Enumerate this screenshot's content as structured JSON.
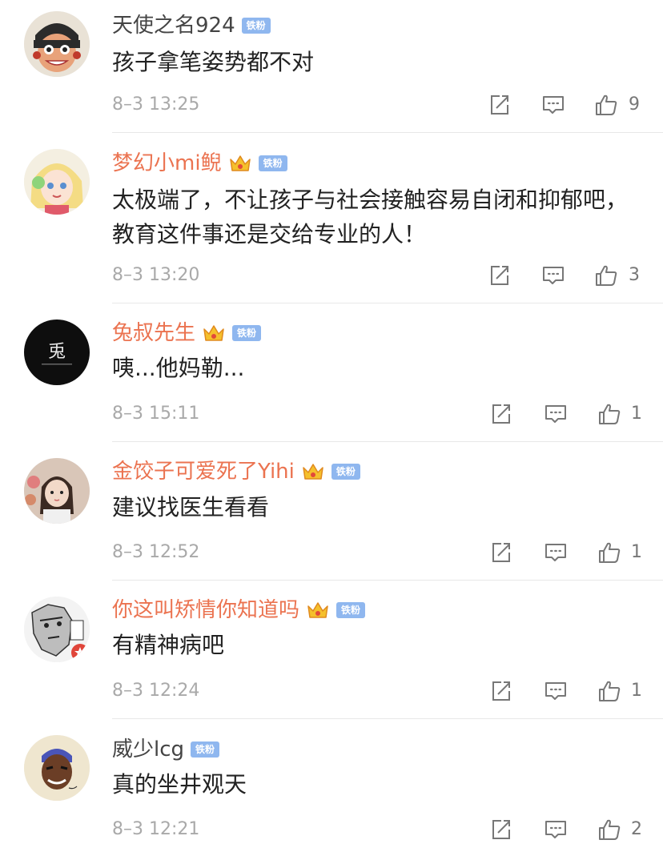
{
  "badge_label": "铁粉",
  "accent_color": "#eb7350",
  "comments": [
    {
      "user": "天使之名924",
      "vip": false,
      "text": "孩子拿笔姿势都不对",
      "time": "8–3 13:25",
      "likes": "9",
      "avatar": "cartoon-kid"
    },
    {
      "user": "梦幻小mi鲵",
      "vip": true,
      "text": "太极端了，不让孩子与社会接触容易自闭和抑郁吧，教育这件事还是交给专业的人！",
      "time": "8–3 13:20",
      "likes": "3",
      "avatar": "anime-girl"
    },
    {
      "user": "兔叔先生",
      "vip": true,
      "text": "咦...他妈勒...",
      "time": "8–3 15:11",
      "likes": "1",
      "avatar": "dark-logo",
      "avatar_text": "兎"
    },
    {
      "user": "金饺子可爱死了Yihi",
      "vip": true,
      "text": "建议找医生看看",
      "time": "8–3 12:52",
      "likes": "1",
      "avatar": "photo-girl"
    },
    {
      "user": "你这叫矫情你知道吗",
      "vip": true,
      "text": "有精神病吧",
      "time": "8–3 12:24",
      "likes": "1",
      "avatar": "manga-sketch"
    },
    {
      "user": "威少lcg",
      "vip": false,
      "text": "真的坐井观天",
      "time": "8–3 12:21",
      "likes": "2",
      "avatar": "basketball-cartoon"
    }
  ]
}
